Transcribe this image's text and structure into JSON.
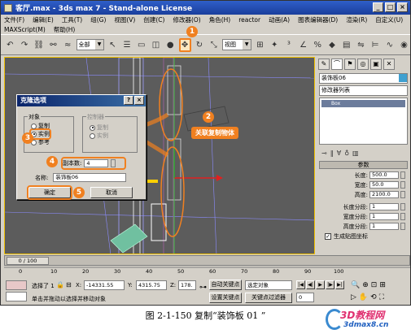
{
  "title": "客厅.max - 3ds max 7 - Stand-alone License",
  "menu": {
    "row1": [
      "文件(F)",
      "编辑(E)",
      "工具(T)",
      "组(G)",
      "视图(V)",
      "创建(C)",
      "修改器(O)",
      "角色(H)",
      "reactor",
      "动画(A)",
      "图表编辑器(D)",
      "渲染(R)",
      "自定义(U)"
    ],
    "row2": [
      "MAXScript(M)",
      "帮助(H)"
    ]
  },
  "toolbar": {
    "selection_filter": "全部",
    "view_dropdown": "视图"
  },
  "viewport": {
    "label": ""
  },
  "right_panel": {
    "object_name": "装饰板06",
    "modifier_list": "修改器列表",
    "stack_item": "Box",
    "params_title": "参数",
    "params": [
      {
        "label": "长度:",
        "value": "500.0"
      },
      {
        "label": "宽度:",
        "value": "50.0"
      },
      {
        "label": "高度:",
        "value": "2100.0"
      },
      {
        "label": "长度分段:",
        "value": "1"
      },
      {
        "label": "宽度分段:",
        "value": "1"
      },
      {
        "label": "高度分段:",
        "value": "1"
      }
    ],
    "gen_mapping": "生成贴图坐标",
    "color": "#3fa0d0"
  },
  "dialog": {
    "title": "克隆选项",
    "object_group": "对象",
    "object_options": [
      "复制",
      "实例",
      "参考"
    ],
    "controller_group": "控制器",
    "controller_options": [
      "复制",
      "实例"
    ],
    "copies_label": "副本数:",
    "copies_value": "4",
    "name_label": "名称:",
    "name_value": "装饰板06",
    "ok": "确定",
    "cancel": "取消"
  },
  "annotations": {
    "c1": "1",
    "c2": "2",
    "c3": "3",
    "c4": "4",
    "c5": "5",
    "box_text": "关联复制物体",
    "accent": "#f08020"
  },
  "timeline": {
    "frame": "0 / 100"
  },
  "ruler_ticks": [
    "0",
    "10",
    "20",
    "30",
    "40",
    "50",
    "60",
    "70",
    "80",
    "90",
    "100"
  ],
  "status": {
    "selected": "选择了 1",
    "x_value": "-14331.55",
    "y_value": "4315.75",
    "z_value": "178.",
    "hint": "单击并拖动以选择并移动对象",
    "auto_key": "自动关键点",
    "set_key": "设置关键点",
    "selected_object": "选定对象",
    "key_filters": "关键点过滤器",
    "frame_field": "0"
  },
  "caption": "图 2-1-150   复制“装饰板 01 ”",
  "logo": {
    "l1": "3D教程网",
    "l2": "3dmax8.cn"
  }
}
